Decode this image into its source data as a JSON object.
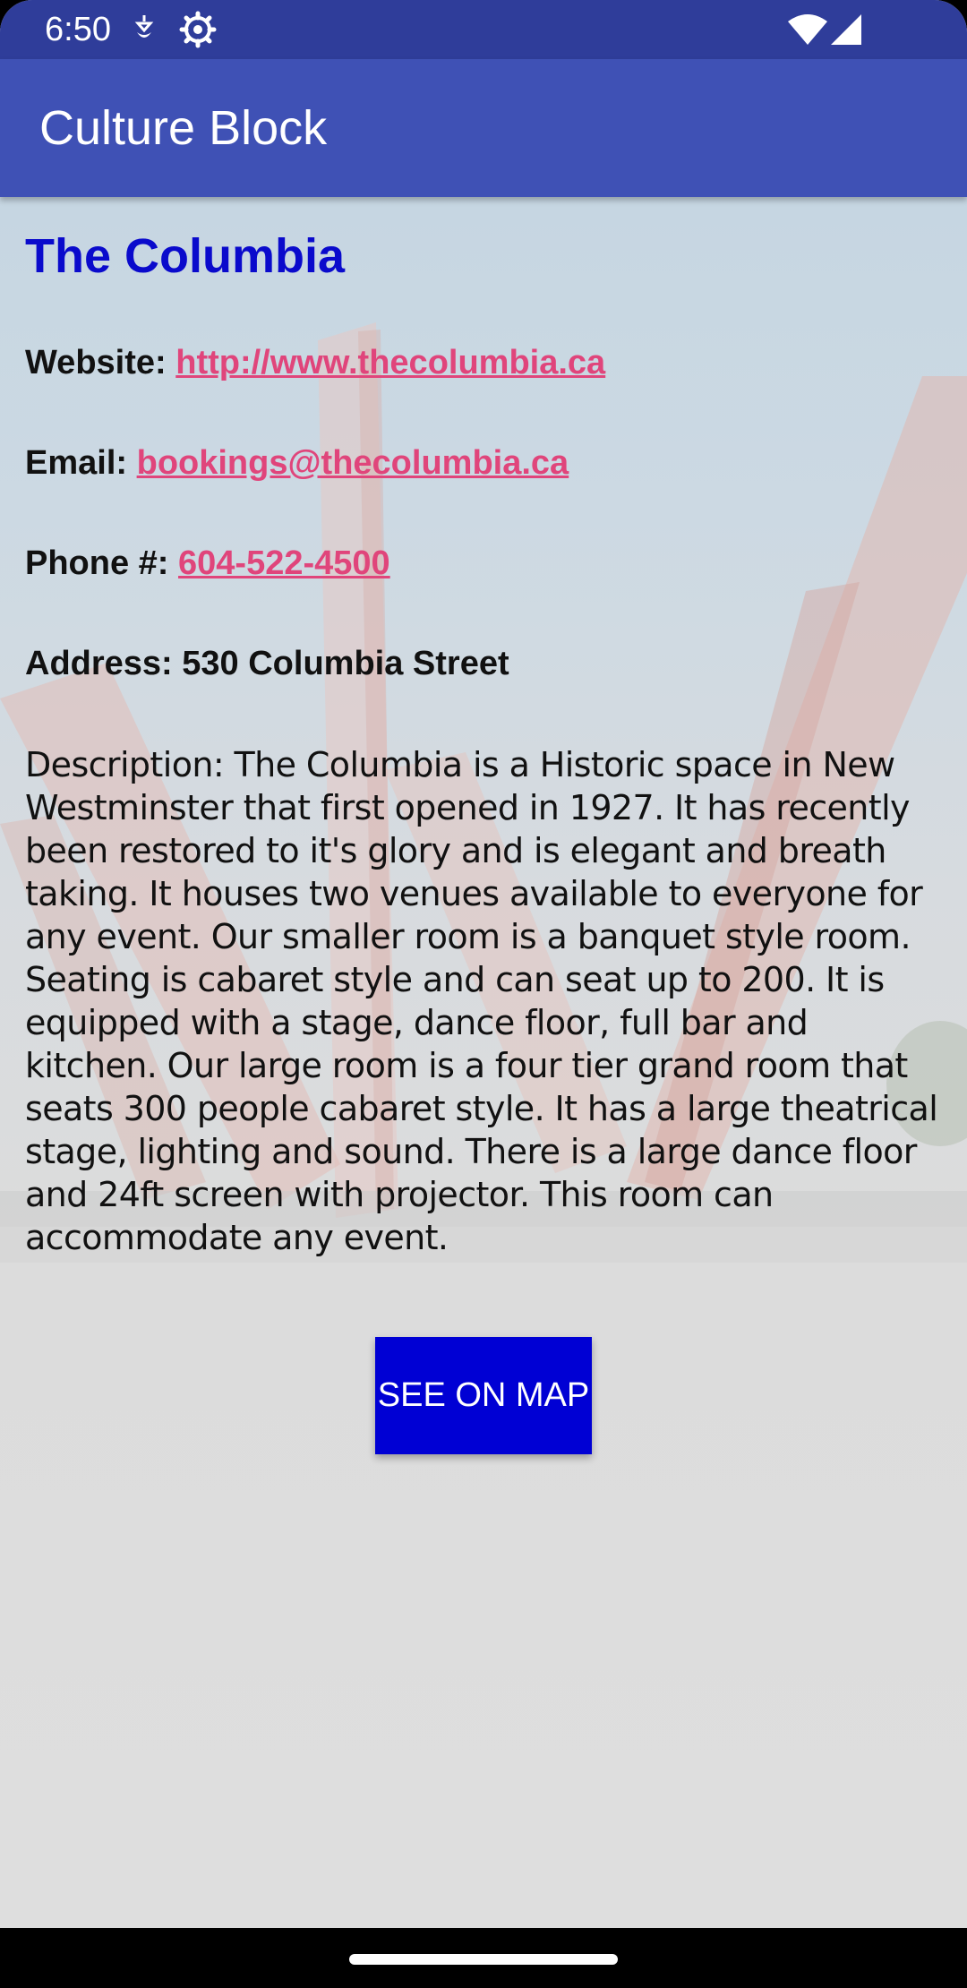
{
  "status_bar": {
    "time": "6:50",
    "icons": [
      "location-icon",
      "settings-icon",
      "wifi-icon",
      "signal-icon"
    ]
  },
  "app_bar": {
    "title": "Culture Block"
  },
  "venue": {
    "name": "The Columbia",
    "website_label": "Website:",
    "website": "http://www.thecolumbia.ca",
    "email_label": "Email:",
    "email": "bookings@thecolumbia.ca",
    "phone_label": "Phone #:",
    "phone": "604-522-4500",
    "address_label": "Address:",
    "address": "530 Columbia Street",
    "description": "Description: The Columbia is a Historic space in New Westminster that first opened in 1927. It has recently been restored to it's glory and is elegant and breath taking. It houses two venues available to everyone for any event. Our smaller room is a banquet style room. Seating is cabaret style and can seat up to 200. It is equipped with a stage, dance floor, full bar and kitchen. Our large room is a four tier grand room that seats 300 people cabaret style. It has a large theatrical stage, lighting and sound. There is a large dance floor and 24ft screen with projector. This room can accommodate any event."
  },
  "actions": {
    "map_button": "SEE ON MAP"
  },
  "colors": {
    "status_bar": "#2f3d9a",
    "app_bar": "#3f51b5",
    "title": "#0a0acc",
    "link": "#e0457b",
    "button": "#0000d4"
  }
}
